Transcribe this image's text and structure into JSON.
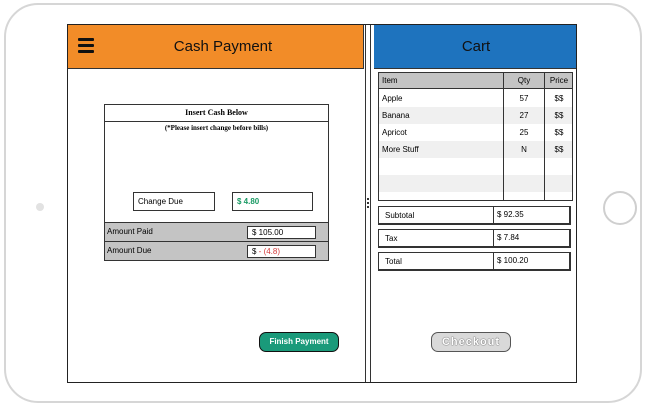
{
  "payment": {
    "title": "Cash Payment",
    "menu_icon": "hamburger-menu-icon",
    "insert_title": "Insert Cash Below",
    "insert_note": "(*Please insert change before bills)",
    "change_due_label": "Change Due",
    "change_due_value": "$ 4.80",
    "amount_paid_label": "Amount Paid",
    "amount_paid_value": "$ 105.00",
    "amount_due_label": "Amount Due",
    "amount_due_currency": "$",
    "amount_due_value": " - (4.8)",
    "finish_label": "Finish Payment"
  },
  "cart": {
    "title": "Cart",
    "columns": {
      "item": "Item",
      "qty": "Qty",
      "price": "Price"
    },
    "items": [
      {
        "name": "Apple",
        "qty": "57",
        "price": "$$"
      },
      {
        "name": "Banana",
        "qty": "27",
        "price": "$$"
      },
      {
        "name": "Apricot",
        "qty": "25",
        "price": "$$"
      },
      {
        "name": "More Stuff",
        "qty": "N",
        "price": "$$"
      }
    ],
    "subtotal_label": "Subtotal",
    "subtotal_value": "$ 92.35",
    "tax_label": "Tax",
    "tax_value": "$ 7.84",
    "total_label": "Total",
    "total_value": "$ 100.20",
    "checkout_label": "Checkout"
  },
  "colors": {
    "payment_header": "#f28c28",
    "cart_header": "#1e73be",
    "finish_button": "#1a9a7a",
    "change_value": "#1a9a64",
    "amount_due_negative": "#d43a3a"
  }
}
